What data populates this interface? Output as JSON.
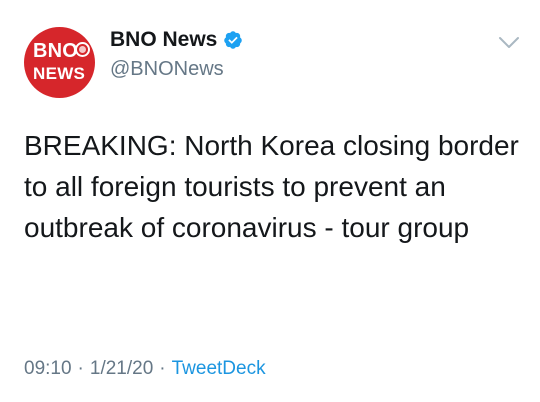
{
  "avatar": {
    "line1": "BNO",
    "line2": "NEWS",
    "brand_color": "#d6262b"
  },
  "account": {
    "display_name": "BNO News",
    "handle": "@BNONews",
    "verified": true,
    "verified_color": "#1da1f2"
  },
  "tweet": {
    "text": "BREAKING: North Korea closing border to all foreign tourists to prevent an outbreak of coronavirus - tour group",
    "time": "09:10",
    "date": "1/21/20",
    "source": "TweetDeck",
    "separator": "·"
  },
  "icons": {
    "menu": "chevron-down-icon",
    "verified": "verified-badge-icon"
  },
  "colors": {
    "text": "#14171a",
    "muted": "#657786",
    "link": "#1b95e0"
  }
}
